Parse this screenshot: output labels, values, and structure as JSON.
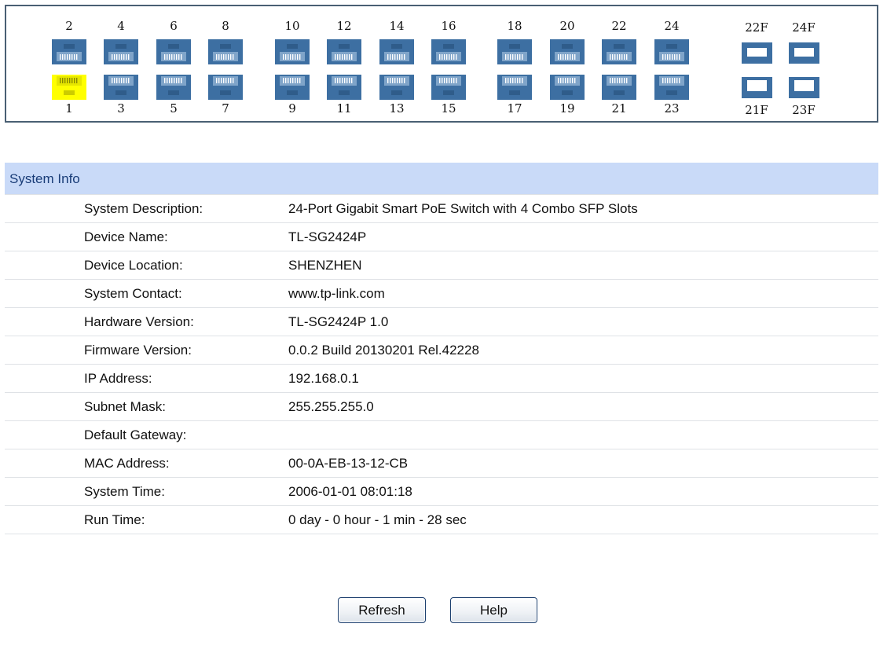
{
  "port_panel": {
    "top_row_ports": [
      "2",
      "4",
      "6",
      "8",
      "10",
      "12",
      "14",
      "16",
      "18",
      "20",
      "22",
      "24"
    ],
    "bottom_row_ports": [
      "1",
      "3",
      "5",
      "7",
      "9",
      "11",
      "13",
      "15",
      "17",
      "19",
      "21",
      "23"
    ],
    "sfp_top_labels": [
      "22F",
      "24F"
    ],
    "sfp_bottom_labels": [
      "21F",
      "23F"
    ],
    "active_port": "1",
    "colors": {
      "port_idle": "#3d6fa2",
      "port_active": "#ffff00",
      "panel_border": "#4a5f73"
    }
  },
  "system_info": {
    "title": "System Info",
    "header_color": "#c9daf8",
    "rows": [
      {
        "label": "System Description:",
        "value": "24-Port Gigabit Smart PoE Switch with 4 Combo SFP Slots"
      },
      {
        "label": "Device Name:",
        "value": "TL-SG2424P"
      },
      {
        "label": "Device Location:",
        "value": "SHENZHEN"
      },
      {
        "label": "System Contact:",
        "value": "www.tp-link.com"
      },
      {
        "label": "Hardware Version:",
        "value": "TL-SG2424P 1.0"
      },
      {
        "label": "Firmware Version:",
        "value": "0.0.2 Build 20130201 Rel.42228"
      },
      {
        "label": "IP Address:",
        "value": "192.168.0.1"
      },
      {
        "label": "Subnet Mask:",
        "value": "255.255.255.0"
      },
      {
        "label": "Default Gateway:",
        "value": ""
      },
      {
        "label": "MAC Address:",
        "value": "00-0A-EB-13-12-CB"
      },
      {
        "label": "System Time:",
        "value": "2006-01-01 08:01:18"
      },
      {
        "label": "Run Time:",
        "value": "0 day - 0 hour - 1 min - 28 sec"
      }
    ]
  },
  "buttons": {
    "refresh_label": "Refresh",
    "help_label": "Help"
  }
}
